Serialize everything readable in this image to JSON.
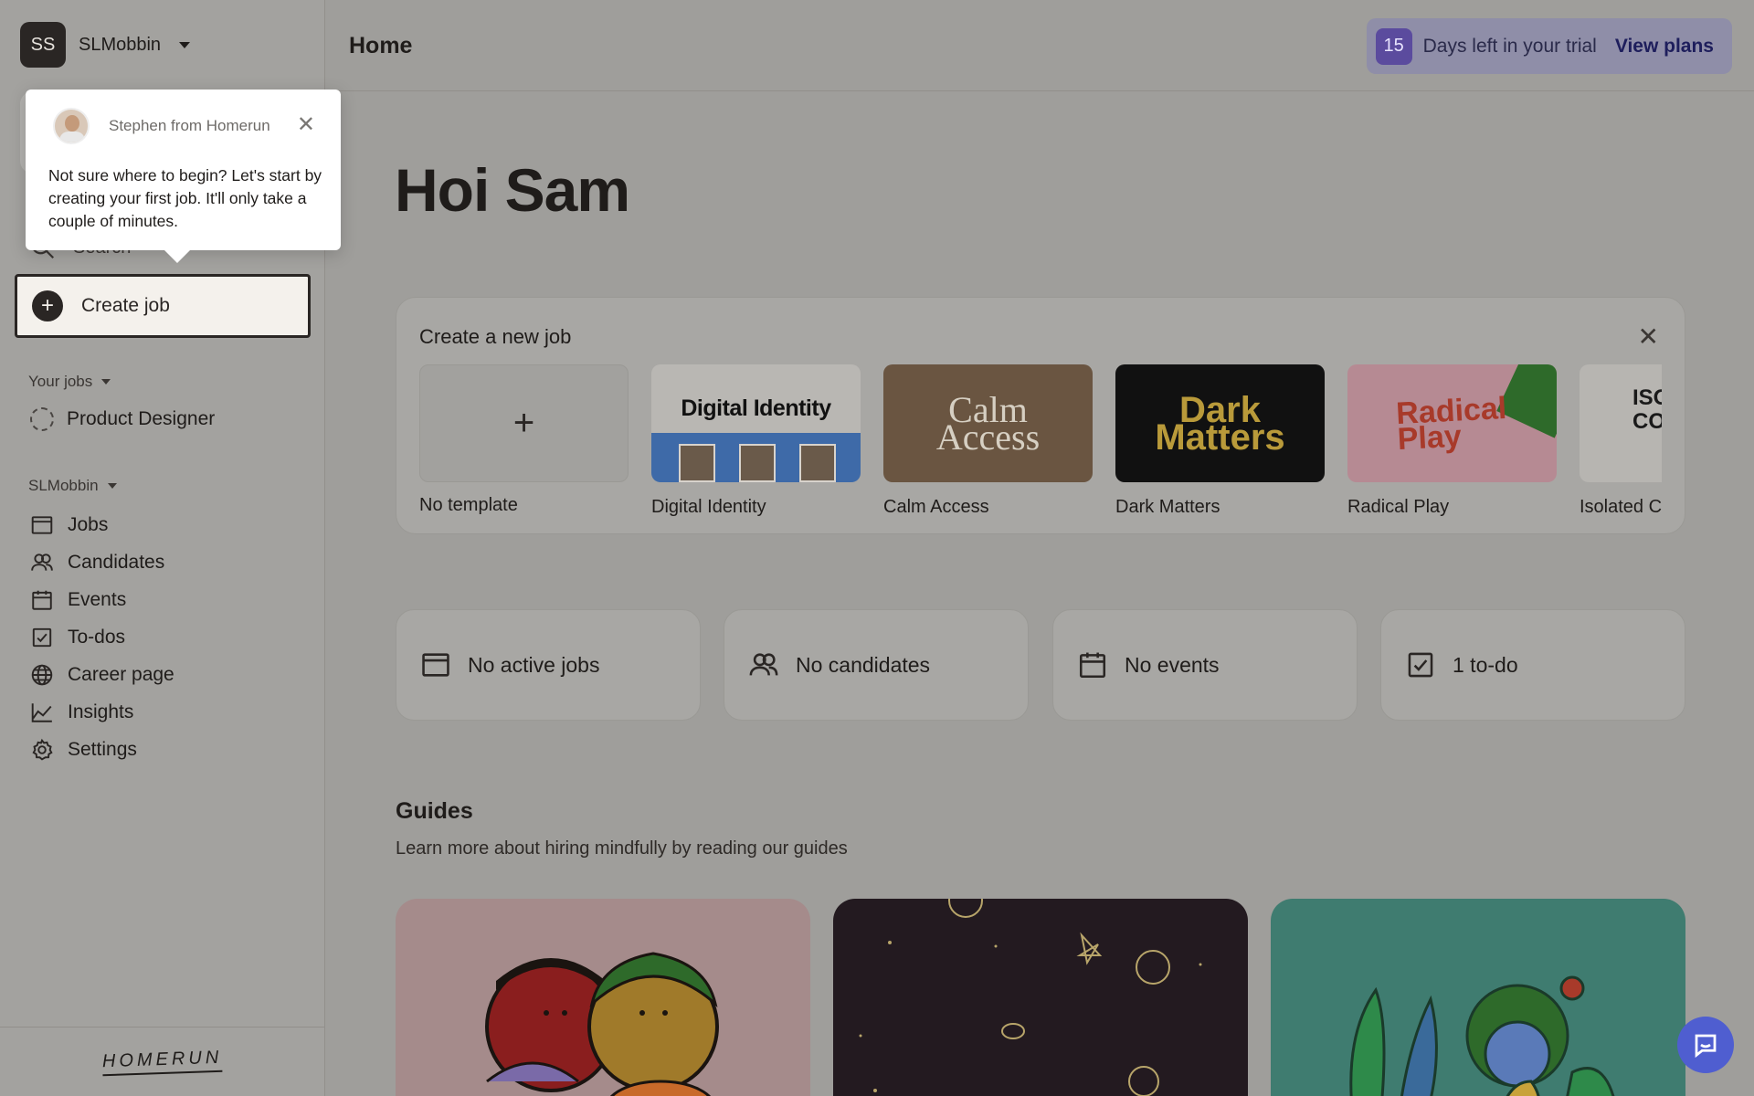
{
  "account": {
    "initials": "SS",
    "name": "SLMobbin"
  },
  "sidebar": {
    "search_label": "Search",
    "create_job_label": "Create job",
    "your_jobs_label": "Your jobs",
    "jobs": [
      {
        "label": "Product Designer"
      }
    ],
    "workspace_label": "SLMobbin",
    "nav": [
      {
        "label": "Jobs",
        "icon": "browser-window-icon"
      },
      {
        "label": "Candidates",
        "icon": "people-icon"
      },
      {
        "label": "Events",
        "icon": "calendar-icon"
      },
      {
        "label": "To-dos",
        "icon": "checkbox-icon"
      },
      {
        "label": "Career page",
        "icon": "globe-icon"
      },
      {
        "label": "Insights",
        "icon": "line-chart-icon"
      },
      {
        "label": "Settings",
        "icon": "gear-icon"
      }
    ],
    "logo_text": "HOMERUN"
  },
  "header": {
    "title": "Home",
    "trial_days": "15",
    "trial_text": "Days left in your trial",
    "view_plans_label": "View plans"
  },
  "main": {
    "greeting": "Hoi Sam",
    "create_panel": {
      "title": "Create a new job",
      "templates": [
        {
          "name": "No template",
          "thumb_text": "+"
        },
        {
          "name": "Digital Identity",
          "thumb_text": "Digital Identity"
        },
        {
          "name": "Calm Access",
          "thumb_text": "Calm Access"
        },
        {
          "name": "Dark Matters",
          "thumb_text": "Dark Matters"
        },
        {
          "name": "Radical Play",
          "thumb_text": "Radical Play"
        },
        {
          "name": "Isolated C",
          "thumb_text": "ISO CO"
        }
      ]
    },
    "stats": [
      {
        "label": "No active jobs",
        "icon": "browser-window-icon"
      },
      {
        "label": "No candidates",
        "icon": "people-icon"
      },
      {
        "label": "No events",
        "icon": "calendar-icon"
      },
      {
        "label": "1 to-do",
        "icon": "checkbox-icon"
      }
    ],
    "guides": {
      "title": "Guides",
      "subtitle": "Learn more about hiring mindfully by reading our guides"
    }
  },
  "popover": {
    "from": "Stephen from Homerun",
    "body": "Not sure where to begin? Let's start by creating your first job. It'll only take a couple of minutes."
  },
  "colors": {
    "accent": "#4f5ed0",
    "trial_badge": "#5b4b9e",
    "dark": "#2a2624"
  }
}
